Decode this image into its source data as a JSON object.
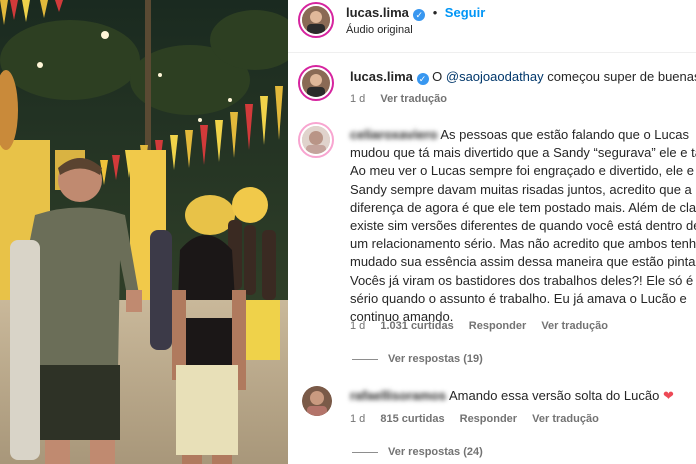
{
  "header": {
    "username": "lucas.lima",
    "follow_label": "Seguir",
    "audio_label": "Áudio original"
  },
  "caption": {
    "username": "lucas.lima",
    "text_before": "O",
    "mention": "@saojoaodathay",
    "text_after": "começou super de buenas",
    "time": "1 d",
    "translate": "Ver tradução"
  },
  "comments": [
    {
      "username": "celiaroxaviero",
      "lines": [
        "As pessoas que estão falando que o Lucas",
        "mudou que tá mais divertido que a Sandy “segurava” ele e ta",
        "Ao meu ver o Lucas sempre foi engraçado e divertido, ele e a",
        "Sandy sempre davam muitas risadas juntos, acredito que a",
        "diferença de agora é que ele tem postado mais. Além de clar",
        "existe sim versões diferentes de quando você está dentro de",
        "um relacionamento sério. Mas não acredito que ambos tenha",
        "mudado sua essência assim dessa maneira que estão pintand",
        "Vocês já viram os bastidores dos trabalhos deles?! Ele só é m",
        "sério quando o assunto é trabalho. Eu já amava o Lucão e",
        "continuo amando."
      ],
      "time": "1 d",
      "likes": "1.031 curtidas",
      "reply": "Responder",
      "translate": "Ver tradução",
      "view_replies": "Ver respostas (19)"
    },
    {
      "username": "rafaellisoramos",
      "text": "Amando essa versão solta do Lucão",
      "emoji": "❤",
      "time": "1 d",
      "likes": "815 curtidas",
      "reply": "Responder",
      "translate": "Ver tradução",
      "view_replies": "Ver respostas (24)"
    }
  ],
  "icons": {
    "verified": "verified-badge-icon",
    "heart": "heart-emoji"
  },
  "colors": {
    "follow": "#0095f6",
    "verified": "#3897f0",
    "mention": "#00376b",
    "heart": "#ed4956"
  }
}
